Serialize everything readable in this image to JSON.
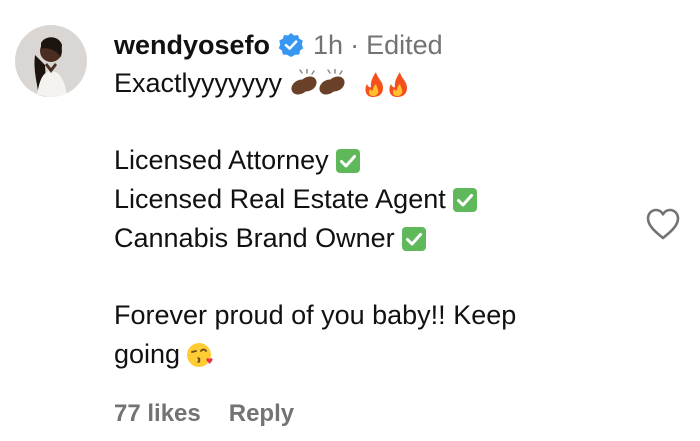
{
  "comment": {
    "username": "wendyosefo",
    "time": "1h",
    "separator": "·",
    "edited": "Edited",
    "lines": {
      "l1": "Exactlyyyyyyy",
      "l2": "Licensed Attorney",
      "l3": "Licensed Real Estate Agent",
      "l4": "Cannabis Brand Owner",
      "l5": "Forever proud of you baby!! Keep",
      "l6": "going"
    },
    "likes": "77 likes",
    "reply": "Reply"
  },
  "icons": {
    "verified": "verified-badge-icon",
    "heart": "heart-outline-icon"
  },
  "colors": {
    "verified_blue": "#3897f0",
    "muted_text": "#737373",
    "check_green": "#5fb85a"
  }
}
